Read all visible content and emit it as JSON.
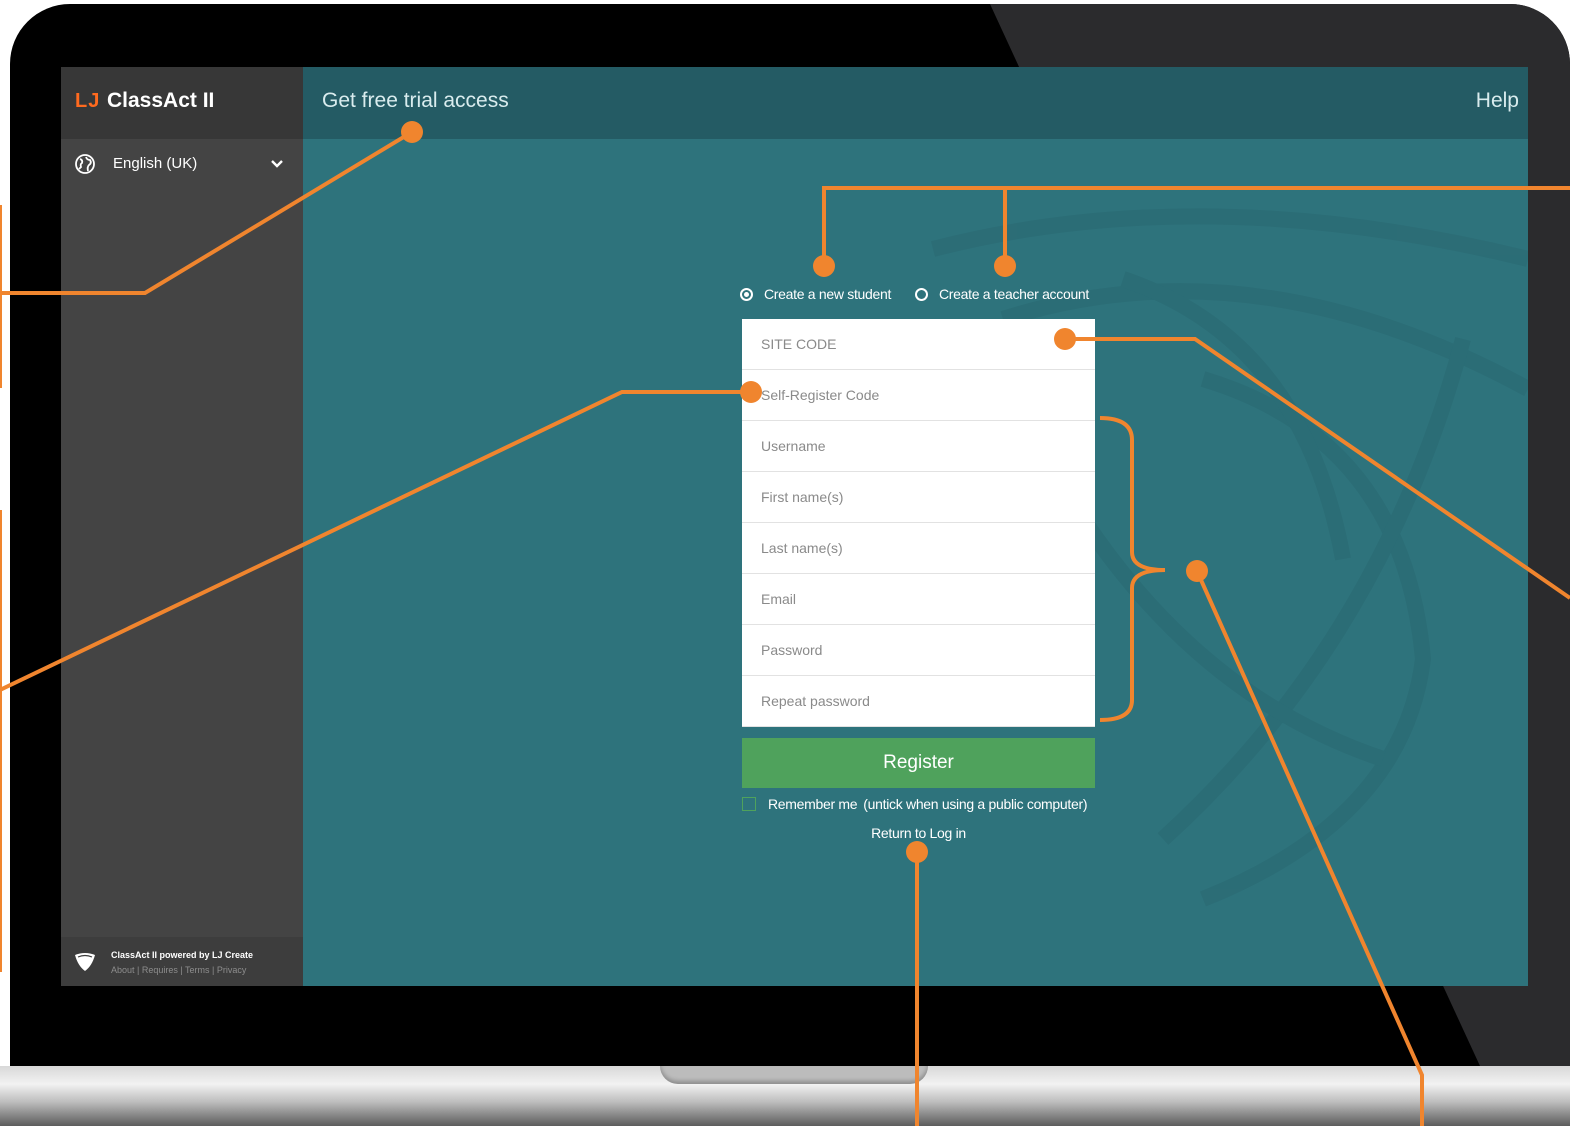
{
  "app": {
    "brand_logo": "LJ",
    "brand_name": "ClassAct II"
  },
  "sidebar": {
    "language": "English (UK)",
    "footer_title": "ClassAct II powered by LJ Create",
    "footer_links": "About | Requires | Terms | Privacy"
  },
  "header": {
    "title": "Get free trial access",
    "help": "Help"
  },
  "account_type": {
    "options": [
      {
        "label": "Create a new student",
        "selected": true
      },
      {
        "label": "Create a teacher account",
        "selected": false
      }
    ]
  },
  "form": {
    "fields": [
      {
        "placeholder": "SITE CODE",
        "value": ""
      },
      {
        "placeholder": "Self-Register Code",
        "value": ""
      },
      {
        "placeholder": "Username",
        "value": ""
      },
      {
        "placeholder": "First name(s)",
        "value": ""
      },
      {
        "placeholder": "Last name(s)",
        "value": ""
      },
      {
        "placeholder": "Email",
        "value": ""
      },
      {
        "placeholder": "Password",
        "value": ""
      },
      {
        "placeholder": "Repeat password",
        "value": ""
      }
    ],
    "register_label": "Register",
    "remember_label": "Remember me",
    "remember_note": "(untick when using a public computer)",
    "remember_checked": false,
    "return_link": "Return to Log in"
  },
  "colors": {
    "accent_orange": "#f0852e",
    "register_green": "#4fa25c",
    "content_teal": "#2e737c",
    "header_teal": "#245b64",
    "sidebar_dark": "#444444"
  }
}
